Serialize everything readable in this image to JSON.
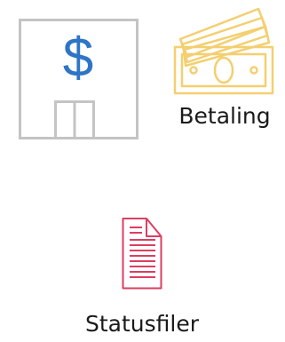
{
  "tiles": {
    "bank": {
      "icon": "bank-building-dollar-icon",
      "dollar_sign": "$",
      "frame_color": "#c4c4c4",
      "accent_color": "#2e75c7"
    },
    "payment": {
      "icon": "banknotes-icon",
      "label": "Betaling",
      "accent_color": "#f4cf70"
    },
    "statusfiles": {
      "icon": "document-icon",
      "label": "Statusfiler",
      "accent_color": "#dc3e62"
    }
  }
}
